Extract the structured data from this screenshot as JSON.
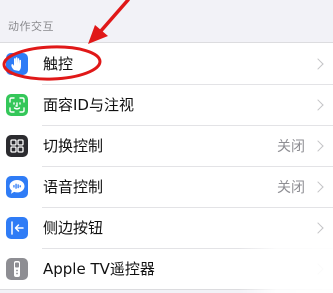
{
  "section": {
    "header": "动作交互"
  },
  "items": [
    {
      "label": "触控",
      "value": "",
      "icon": "hand-touch-icon",
      "icon_color": "#2f7cf6"
    },
    {
      "label": "面容ID与注视",
      "value": "",
      "icon": "face-id-icon",
      "icon_color": "#34c759"
    },
    {
      "label": "切换控制",
      "value": "关闭",
      "icon": "switch-control-icon",
      "icon_color": "#2b2b2f"
    },
    {
      "label": "语音控制",
      "value": "关闭",
      "icon": "voice-control-icon",
      "icon_color": "#2f7cf6"
    },
    {
      "label": "侧边按钮",
      "value": "",
      "icon": "side-button-icon",
      "icon_color": "#2f7cf6"
    },
    {
      "label": "Apple TV遥控器",
      "value": "",
      "icon": "apple-tv-remote-icon",
      "icon_color": "#8e8e93"
    }
  ],
  "colors": {
    "annotation": "#e01818",
    "background": "#f2f2f7"
  }
}
